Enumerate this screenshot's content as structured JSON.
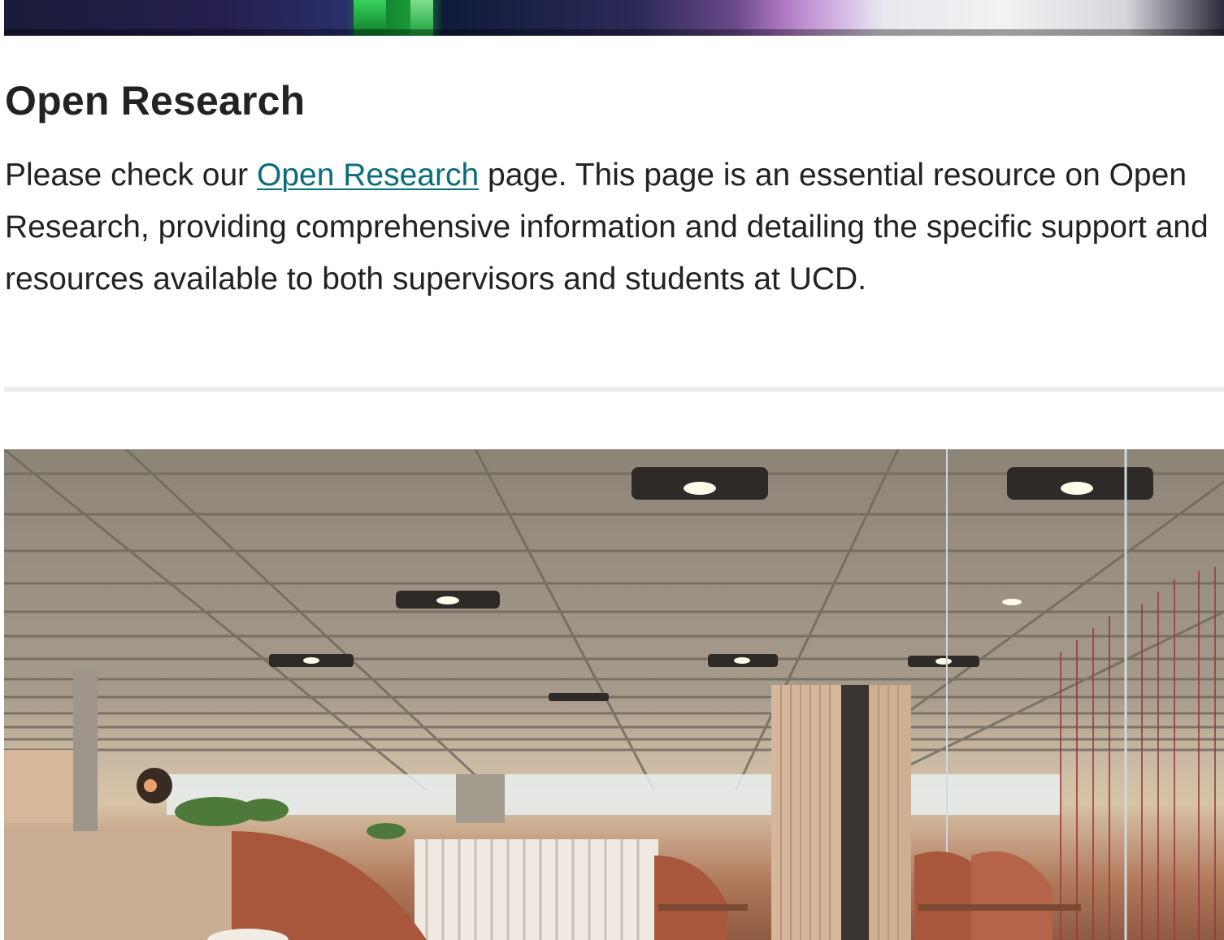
{
  "section": {
    "heading": "Open Research",
    "text_before_link": "Please check our ",
    "link_text": "Open Research",
    "text_after_link": " page. This page is an essential resource on Open Research, providing comprehensive information and detailing the specific support and resources available to both supervisors and students at UCD."
  },
  "colors": {
    "link": "#0a6e7a",
    "text": "#222222",
    "divider": "#ececec"
  }
}
